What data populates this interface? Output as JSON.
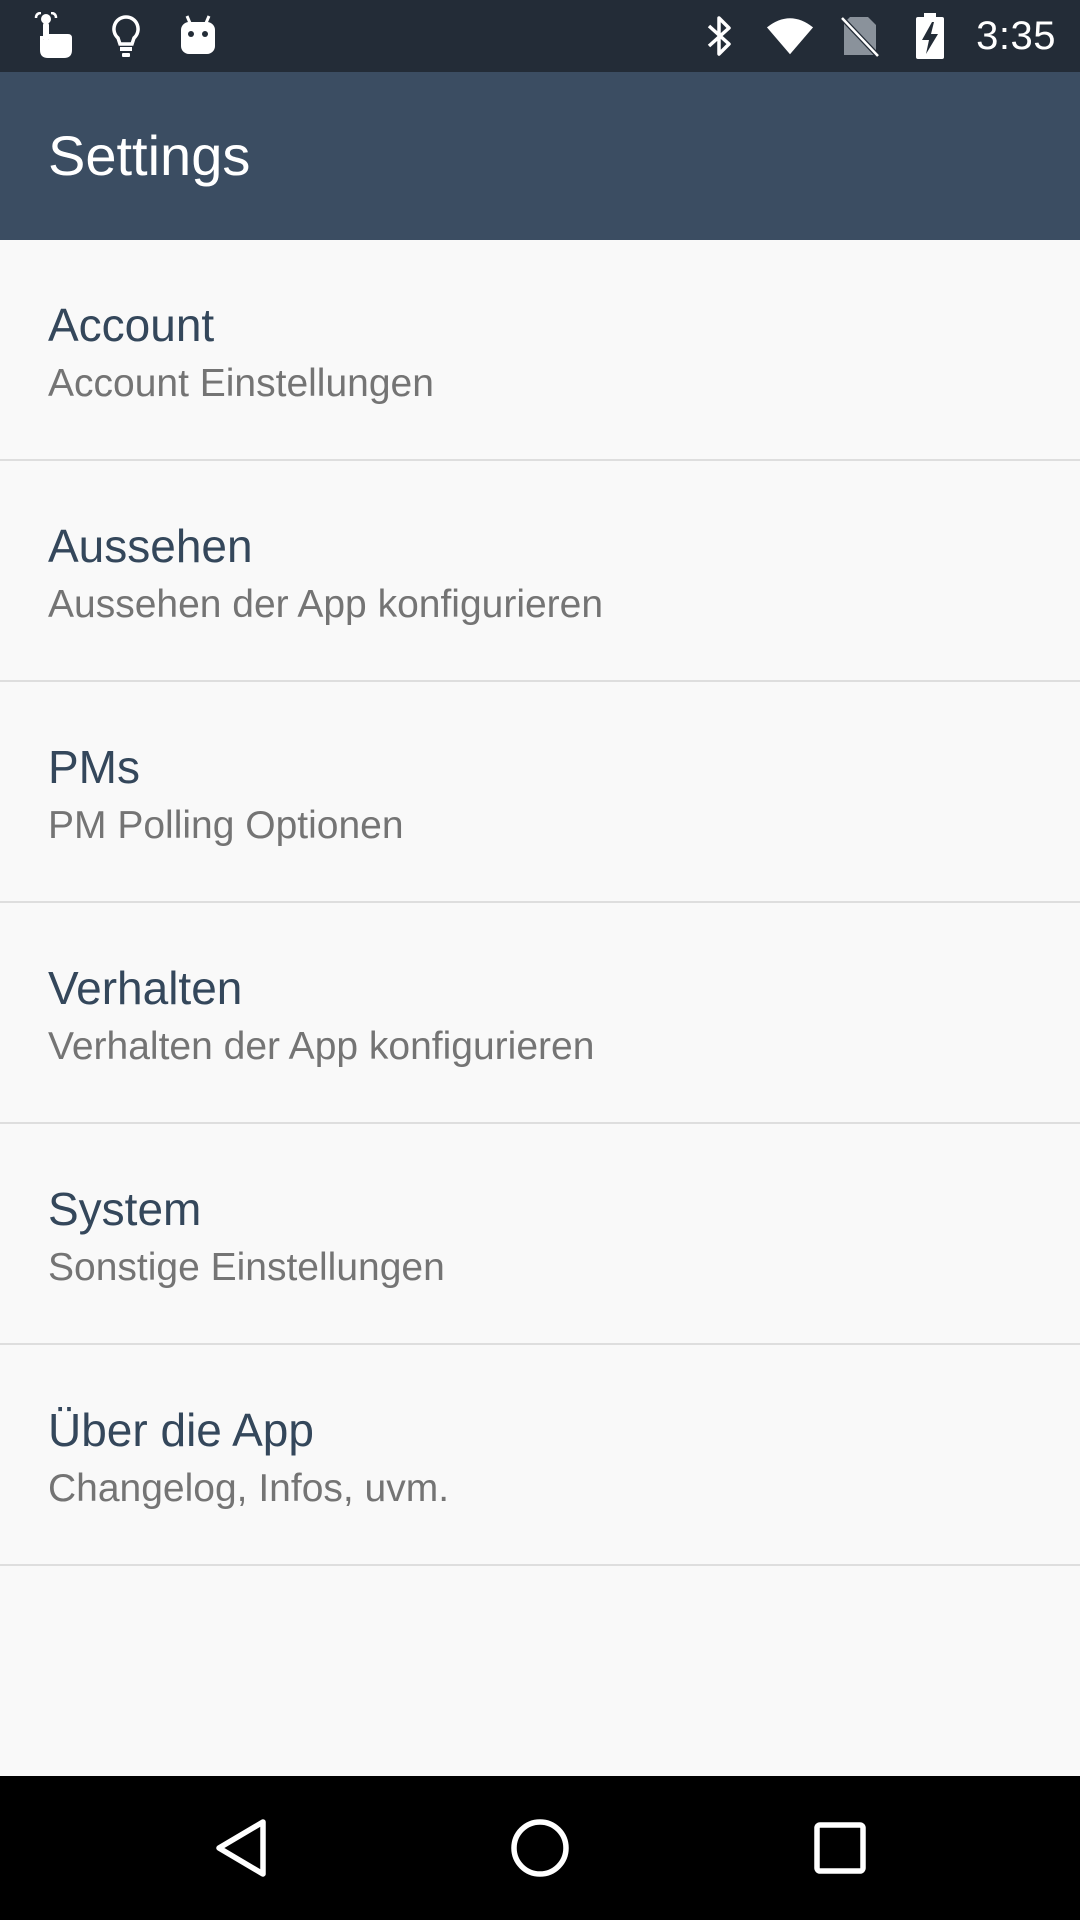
{
  "status_bar": {
    "time": "3:35",
    "left_icons": [
      "touch-hand-icon",
      "lightbulb-icon",
      "android-icon"
    ],
    "right_icons": [
      "bluetooth-icon",
      "wifi-icon",
      "no-sim-icon",
      "battery-charging-icon"
    ]
  },
  "toolbar": {
    "title": "Settings",
    "color": "#3b4d62"
  },
  "preferences": [
    {
      "title": "Account",
      "summary": "Account Einstellungen"
    },
    {
      "title": "Aussehen",
      "summary": "Aussehen der App konfigurieren"
    },
    {
      "title": "PMs",
      "summary": "PM Polling Optionen"
    },
    {
      "title": "Verhalten",
      "summary": "Verhalten der App konfigurieren"
    },
    {
      "title": "System",
      "summary": "Sonstige Einstellungen"
    },
    {
      "title": "Über die App",
      "summary": "Changelog, Infos, uvm."
    }
  ],
  "nav_bar": {
    "buttons": [
      "back-icon",
      "home-icon",
      "recents-icon"
    ]
  }
}
